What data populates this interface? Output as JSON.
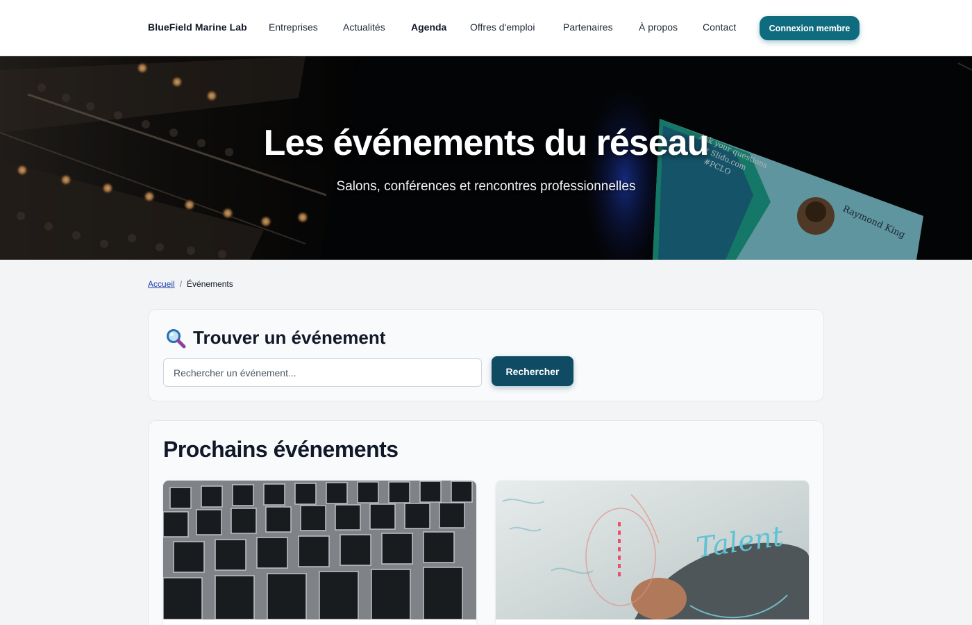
{
  "header": {
    "brand": "BlueField Marine Lab",
    "nav": [
      {
        "label": "Entreprises",
        "active": false
      },
      {
        "label": "Actualités",
        "active": false
      },
      {
        "label": "Agenda",
        "active": true
      },
      {
        "label": "Offres d'emploi",
        "active": false
      },
      {
        "label": "Partenaires",
        "active": false
      },
      {
        "label": "À propos",
        "active": false
      },
      {
        "label": "Contact",
        "active": false
      }
    ],
    "login_label": "Connexion membre"
  },
  "hero": {
    "title": "Les événements du réseau",
    "subtitle": "Salons, conférences et rencontres professionnelles"
  },
  "breadcrumb": {
    "home": "Accueil",
    "separator": "/",
    "current": "Événements"
  },
  "search": {
    "title": "Trouver un événement",
    "icon": "magnifier-icon",
    "placeholder": "Rechercher un événement...",
    "button_label": "Rechercher"
  },
  "events": {
    "title": "Prochains événements",
    "cards": [
      {
        "image": "empty-chairs-rows-photo"
      },
      {
        "image": "talent-whiteboard-photo"
      }
    ]
  },
  "colors": {
    "primary": "#0f6b7e",
    "search_button": "#0f4c63",
    "link": "#1e40af",
    "page_bg": "#f3f4f6"
  }
}
